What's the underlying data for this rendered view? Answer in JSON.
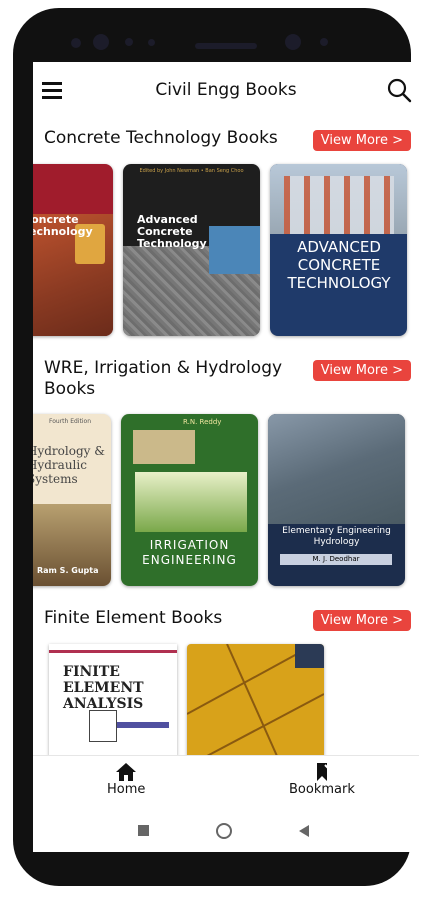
{
  "app": {
    "title": "Civil Engg Books"
  },
  "sections": [
    {
      "title": "Concrete Technology Books",
      "view_more": "View More >",
      "books": [
        {
          "cover_text": "Concrete Technology",
          "color": "#a01c2c"
        },
        {
          "cover_text": "Advanced Concrete Technology",
          "authors": "Edited by John Newman • Ban Seng Choo",
          "color": "#1e1e1e"
        },
        {
          "cover_text": "ADVANCED CONCRETE TECHNOLOGY",
          "color": "#1f3a6a"
        }
      ]
    },
    {
      "title": "WRE, Irrigation & Hydrology Books",
      "view_more": "View More >",
      "books": [
        {
          "cover_text": "Hydrology & Hydraulic Systems",
          "edition": "Fourth Edition",
          "author": "Ram S. Gupta",
          "color": "#f2e6cf"
        },
        {
          "cover_text": "IRRIGATION ENGINEERING",
          "author": "R.N. Reddy",
          "color": "#2f6f2a"
        },
        {
          "cover_text": "Elementary Engineering Hydrology",
          "author": "M. J. Deodhar",
          "color": "#1c2d4c"
        }
      ]
    },
    {
      "title": "Finite Element Books",
      "view_more": "View More >",
      "books": [
        {
          "cover_text": "FINITE ELEMENT ANALYSIS",
          "color": "#ffffff"
        },
        {
          "cover_text": "",
          "color": "#d8a21a"
        }
      ]
    }
  ],
  "bottom_nav": [
    {
      "label": "Home",
      "icon": "home-icon"
    },
    {
      "label": "Bookmark",
      "icon": "bookmark-icon"
    }
  ],
  "colors": {
    "accent": "#e9443d"
  }
}
